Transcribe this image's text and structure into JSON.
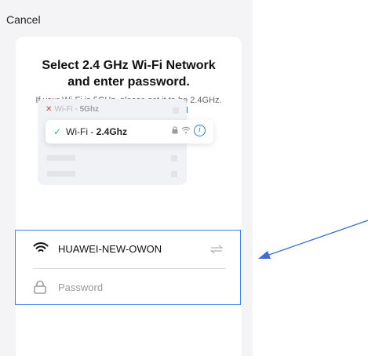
{
  "header": {
    "cancel_label": "Cancel"
  },
  "title_line1": "Select 2.4 GHz Wi-Fi Network",
  "title_line2": "and enter password.",
  "subtitle": "If your Wi-Fi is 5GHz, please set it to be 2.4GHz.",
  "router_link": "Common router setting method",
  "illustration": {
    "wifi5_prefix": "Wi-Fi - ",
    "wifi5_band": "5Ghz",
    "wifi24_prefix": "Wi-Fi - ",
    "wifi24_band": "2.4Ghz"
  },
  "form": {
    "ssid": "HUAWEI-NEW-OWON",
    "password_placeholder": "Password"
  },
  "colors": {
    "accent": "#2f7de1",
    "highlight_border": "#3b82f6",
    "check": "#3fb56b",
    "error": "#e53935"
  },
  "icons": [
    "close-icon",
    "check-icon",
    "lock-icon",
    "wifi-icon",
    "info-icon",
    "switch-network-icon",
    "password-lock-icon"
  ]
}
